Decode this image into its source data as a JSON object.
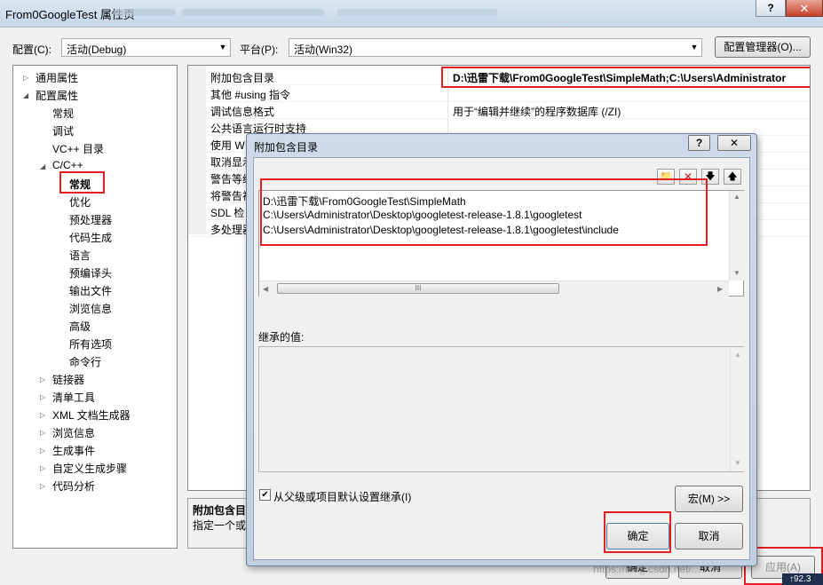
{
  "window": {
    "title": "From0GoogleTest 属性页",
    "help_glyph": "?",
    "close_glyph": "✕"
  },
  "config_row": {
    "config_label": "配置(C):",
    "config_value": "活动(Debug)",
    "platform_label": "平台(P):",
    "platform_value": "活动(Win32)",
    "manager_button": "配置管理器(O)..."
  },
  "tree": {
    "items": [
      {
        "label": "通用属性",
        "expander": "▷"
      },
      {
        "label": "配置属性",
        "expander": "◢"
      },
      {
        "label": "常规"
      },
      {
        "label": "调试"
      },
      {
        "label": "VC++ 目录"
      },
      {
        "label": "C/C++",
        "expander": "◢"
      },
      {
        "label": "常规",
        "selected": true
      },
      {
        "label": "优化"
      },
      {
        "label": "预处理器"
      },
      {
        "label": "代码生成"
      },
      {
        "label": "语言"
      },
      {
        "label": "预编译头"
      },
      {
        "label": "输出文件"
      },
      {
        "label": "浏览信息"
      },
      {
        "label": "高级"
      },
      {
        "label": "所有选项"
      },
      {
        "label": "命令行"
      },
      {
        "label": "链接器",
        "expander": "▷"
      },
      {
        "label": "清单工具",
        "expander": "▷"
      },
      {
        "label": "XML 文档生成器",
        "expander": "▷"
      },
      {
        "label": "浏览信息",
        "expander": "▷"
      },
      {
        "label": "生成事件",
        "expander": "▷"
      },
      {
        "label": "自定义生成步骤",
        "expander": "▷"
      },
      {
        "label": "代码分析",
        "expander": "▷"
      }
    ]
  },
  "grid": {
    "rows": [
      {
        "name": "附加包含目录",
        "value": "D:\\迅雷下载\\From0GoogleTest\\SimpleMath;C:\\Users\\Administrator"
      },
      {
        "name": "其他 #using 指令",
        "value": ""
      },
      {
        "name": "调试信息格式",
        "value": "用于“编辑并继续”的程序数据库 (/ZI)"
      },
      {
        "name": "公共语言运行时支持",
        "value": ""
      },
      {
        "name": "使用 W",
        "value": ""
      },
      {
        "name": "取消显示",
        "value": ""
      },
      {
        "name": "警告等级",
        "value": ""
      },
      {
        "name": "将警告视",
        "value": ""
      },
      {
        "name": "SDL 检",
        "value": ""
      },
      {
        "name": "多处理器",
        "value": ""
      }
    ]
  },
  "description": {
    "title": "附加包含目",
    "text": "指定一个或"
  },
  "bottom_buttons": {
    "ok": "确定",
    "cancel": "取消",
    "apply": "应用(A)"
  },
  "watermark": "https://blog.csdn.net/...",
  "dialog": {
    "title": "附加包含目录",
    "help_glyph": "?",
    "close_glyph": "✕",
    "toolbar_icons": [
      "new-folder-icon",
      "delete-icon",
      "move-down-icon",
      "move-up-icon"
    ],
    "toolbar_glyphs": [
      "📁",
      "✕",
      "🡇",
      "🡅"
    ],
    "entries": [
      "D:\\迅雷下载\\From0GoogleTest\\SimpleMath",
      "C:\\Users\\Administrator\\Desktop\\googletest-release-1.8.1\\googletest",
      "C:\\Users\\Administrator\\Desktop\\googletest-release-1.8.1\\googletest\\include"
    ],
    "inherited_label": "继承的值:",
    "inherit_checkbox_label": "从父级或项目默认设置继承(I)",
    "inherit_checked": true,
    "macro_button": "宏(M) >>",
    "ok_button": "确定",
    "cancel_button": "取消",
    "scroll_thumb_glyph": "III"
  },
  "taskbar": {
    "text": "↑92.3"
  },
  "colors": {
    "highlight_red": "#e02020",
    "selection": "#3399ff",
    "title_gradient_top": "#dbe6f2"
  }
}
